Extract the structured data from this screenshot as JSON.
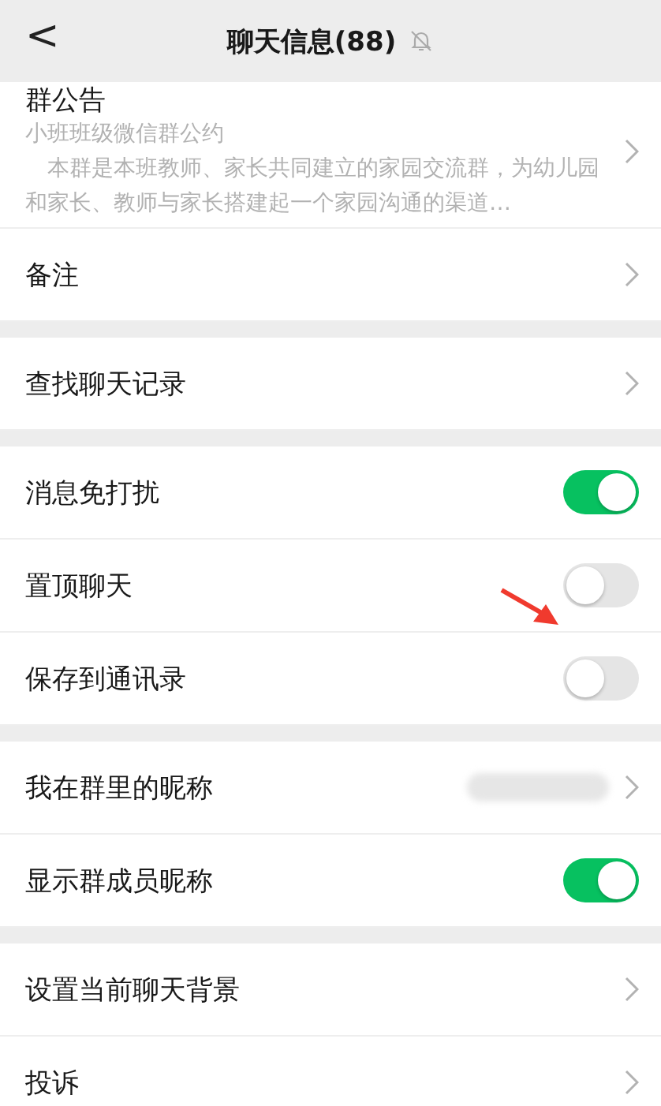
{
  "header": {
    "back": "<",
    "title": "聊天信息(88)",
    "muted": true
  },
  "announcement": {
    "title": "群公告",
    "subtitle": "小班班级微信群公约",
    "body": "　本群是本班教师、家长共同建立的家园交流群，为幼儿园和家长、教师与家长搭建起一个家园沟通的渠道…"
  },
  "sections": [
    {
      "rows": [
        {
          "kind": "link",
          "label": "备注"
        }
      ]
    },
    {
      "rows": [
        {
          "kind": "link",
          "label": "查找聊天记录"
        }
      ]
    },
    {
      "rows": [
        {
          "kind": "toggle",
          "label": "消息免打扰",
          "on": true
        },
        {
          "kind": "toggle",
          "label": "置顶聊天",
          "on": false
        },
        {
          "kind": "toggle",
          "label": "保存到通讯录",
          "on": false
        }
      ]
    },
    {
      "rows": [
        {
          "kind": "redacted-link",
          "label": "我在群里的昵称"
        },
        {
          "kind": "toggle",
          "label": "显示群成员昵称",
          "on": true
        }
      ]
    },
    {
      "rows": [
        {
          "kind": "link",
          "label": "设置当前聊天背景"
        },
        {
          "kind": "link",
          "label": "投诉"
        }
      ]
    }
  ]
}
